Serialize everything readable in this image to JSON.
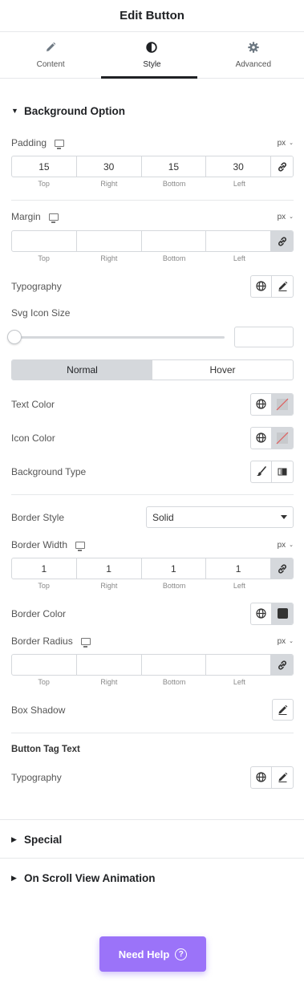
{
  "header": {
    "title": "Edit Button"
  },
  "tabs": [
    {
      "label": "Content",
      "icon": "pencil-icon"
    },
    {
      "label": "Style",
      "icon": "contrast-icon",
      "active": true
    },
    {
      "label": "Advanced",
      "icon": "gear-icon"
    }
  ],
  "background_section": {
    "title": "Background Option",
    "padding": {
      "label": "Padding",
      "unit": "px",
      "values": [
        "15",
        "30",
        "15",
        "30"
      ],
      "linked": false
    },
    "margin": {
      "label": "Margin",
      "unit": "px",
      "values": [
        "",
        "",
        "",
        ""
      ],
      "linked": true
    },
    "dim_labels": [
      "Top",
      "Right",
      "Bottom",
      "Left"
    ],
    "typography": {
      "label": "Typography"
    },
    "svg_icon_size": {
      "label": "Svg Icon Size",
      "value": ""
    },
    "state_tabs": [
      "Normal",
      "Hover"
    ],
    "text_color": {
      "label": "Text Color"
    },
    "icon_color": {
      "label": "Icon Color"
    },
    "background_type": {
      "label": "Background Type"
    },
    "border_style": {
      "label": "Border Style",
      "value": "Solid"
    },
    "border_width": {
      "label": "Border Width",
      "unit": "px",
      "values": [
        "1",
        "1",
        "1",
        "1"
      ],
      "linked": true
    },
    "border_color": {
      "label": "Border Color",
      "swatch": "#333333"
    },
    "border_radius": {
      "label": "Border Radius",
      "unit": "px",
      "values": [
        "",
        "",
        "",
        ""
      ],
      "linked": true
    },
    "box_shadow": {
      "label": "Box Shadow"
    },
    "button_tag_text": {
      "heading": "Button Tag Text",
      "typography_label": "Typography"
    }
  },
  "collapsed_sections": [
    "Special",
    "On Scroll View Animation"
  ],
  "help_button": {
    "label": "Need Help",
    "icon": "question-circle-icon",
    "color": "#9b73f9"
  }
}
